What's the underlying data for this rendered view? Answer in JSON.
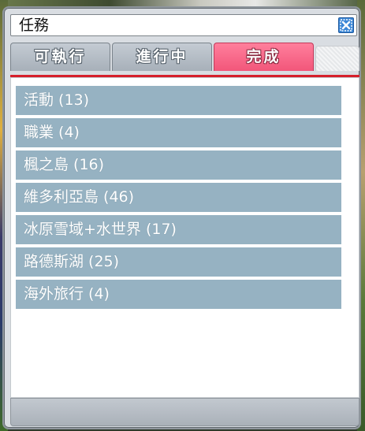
{
  "window": {
    "title": "任務"
  },
  "tabs": [
    {
      "label": "可執行",
      "active": false
    },
    {
      "label": "進行中",
      "active": false
    },
    {
      "label": "完成",
      "active": true
    }
  ],
  "categories": [
    {
      "label": "活動 (13)"
    },
    {
      "label": "職業 (4)"
    },
    {
      "label": "楓之島 (16)"
    },
    {
      "label": "維多利亞島 (46)"
    },
    {
      "label": "冰原雪域+水世界 (17)"
    },
    {
      "label": "路德斯湖 (25)"
    },
    {
      "label": "海外旅行 (4)"
    }
  ],
  "colors": {
    "active_tab": "#f2567a",
    "tab_underline": "#d61f2a",
    "list_item": "#96b2c2",
    "close_button": "#3b86d6"
  },
  "icons": {
    "close": "close-icon"
  }
}
